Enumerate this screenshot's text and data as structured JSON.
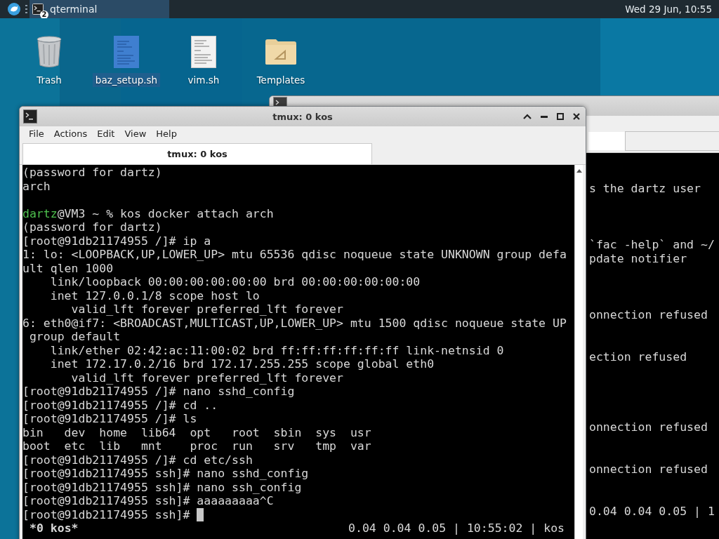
{
  "panel": {
    "task_label": "qterminal",
    "task_count": "2",
    "clock": "Wed 29 Jun, 10:55"
  },
  "desktop_icons": [
    {
      "label": "Trash",
      "kind": "trash",
      "selected": false
    },
    {
      "label": "baz_setup.sh",
      "kind": "script",
      "selected": true
    },
    {
      "label": "vim.sh",
      "kind": "text",
      "selected": false
    },
    {
      "label": "Templates",
      "kind": "folder",
      "selected": false
    }
  ],
  "back_window": {
    "active": false,
    "lines": [
      {
        "kind": "blank"
      },
      {
        "kind": "text",
        "text": "s the dartz user"
      },
      {
        "kind": "blank"
      },
      {
        "kind": "blank"
      },
      {
        "kind": "blank"
      },
      {
        "kind": "text",
        "text": "`fac -help` and ~/"
      },
      {
        "kind": "text",
        "text": "pdate notifier"
      },
      {
        "kind": "blank"
      },
      {
        "kind": "blank"
      },
      {
        "kind": "blank"
      },
      {
        "kind": "text",
        "text": "onnection refused"
      },
      {
        "kind": "blank"
      },
      {
        "kind": "blank"
      },
      {
        "kind": "text",
        "text": "ection refused"
      },
      {
        "kind": "blank"
      },
      {
        "kind": "blank"
      },
      {
        "kind": "blank"
      },
      {
        "kind": "blank"
      },
      {
        "kind": "text",
        "text": "onnection refused"
      },
      {
        "kind": "blank"
      },
      {
        "kind": "blank"
      },
      {
        "kind": "text",
        "text": "onnection refused"
      },
      {
        "kind": "blank"
      },
      {
        "kind": "blank"
      },
      {
        "kind": "text",
        "text": "0.04 0.04 0.05 | 1"
      }
    ]
  },
  "front_window": {
    "title": "tmux: 0 kos",
    "active": true,
    "menu": [
      "File",
      "Actions",
      "Edit",
      "View",
      "Help"
    ],
    "tabs": [
      {
        "label": "tmux: 0 kos",
        "selected": true
      }
    ],
    "lines": [
      {
        "kind": "text",
        "text": "(password for dartz)"
      },
      {
        "kind": "text",
        "text": "arch"
      },
      {
        "kind": "blank"
      },
      {
        "kind": "prompt",
        "user": "dartz",
        "text": "@VM3 ~ % kos docker attach arch"
      },
      {
        "kind": "text",
        "text": "(password for dartz)"
      },
      {
        "kind": "text",
        "text": "[root@91db21174955 /]# ip a"
      },
      {
        "kind": "text",
        "text": "1: lo: <LOOPBACK,UP,LOWER_UP> mtu 65536 qdisc noqueue state UNKNOWN group defa"
      },
      {
        "kind": "text",
        "text": "ult qlen 1000"
      },
      {
        "kind": "text",
        "text": "    link/loopback 00:00:00:00:00:00 brd 00:00:00:00:00:00"
      },
      {
        "kind": "text",
        "text": "    inet 127.0.0.1/8 scope host lo"
      },
      {
        "kind": "text",
        "text": "       valid_lft forever preferred_lft forever"
      },
      {
        "kind": "text",
        "text": "6: eth0@if7: <BROADCAST,MULTICAST,UP,LOWER_UP> mtu 1500 qdisc noqueue state UP"
      },
      {
        "kind": "text",
        "text": " group default"
      },
      {
        "kind": "text",
        "text": "    link/ether 02:42:ac:11:00:02 brd ff:ff:ff:ff:ff:ff link-netnsid 0"
      },
      {
        "kind": "text",
        "text": "    inet 172.17.0.2/16 brd 172.17.255.255 scope global eth0"
      },
      {
        "kind": "text",
        "text": "       valid_lft forever preferred_lft forever"
      },
      {
        "kind": "text",
        "text": "[root@91db21174955 /]# nano sshd_config"
      },
      {
        "kind": "text",
        "text": "[root@91db21174955 /]# cd .."
      },
      {
        "kind": "text",
        "text": "[root@91db21174955 /]# ls"
      },
      {
        "kind": "text",
        "text": "bin   dev  home  lib64  opt   root  sbin  sys  usr"
      },
      {
        "kind": "text",
        "text": "boot  etc  lib   mnt    proc  run   srv   tmp  var"
      },
      {
        "kind": "text",
        "text": "[root@91db21174955 /]# cd etc/ssh"
      },
      {
        "kind": "text",
        "text": "[root@91db21174955 ssh]# nano sshd_config"
      },
      {
        "kind": "text",
        "text": "[root@91db21174955 ssh]# nano ssh_config"
      },
      {
        "kind": "text",
        "text": "[root@91db21174955 ssh]# aaaaaaaaa^C"
      },
      {
        "kind": "input",
        "text": "[root@91db21174955 ssh]#",
        "cursor": true
      }
    ],
    "status_left": "*0 kos*",
    "status_right": "0.04 0.04 0.05 | 10:55:02 | kos"
  }
}
